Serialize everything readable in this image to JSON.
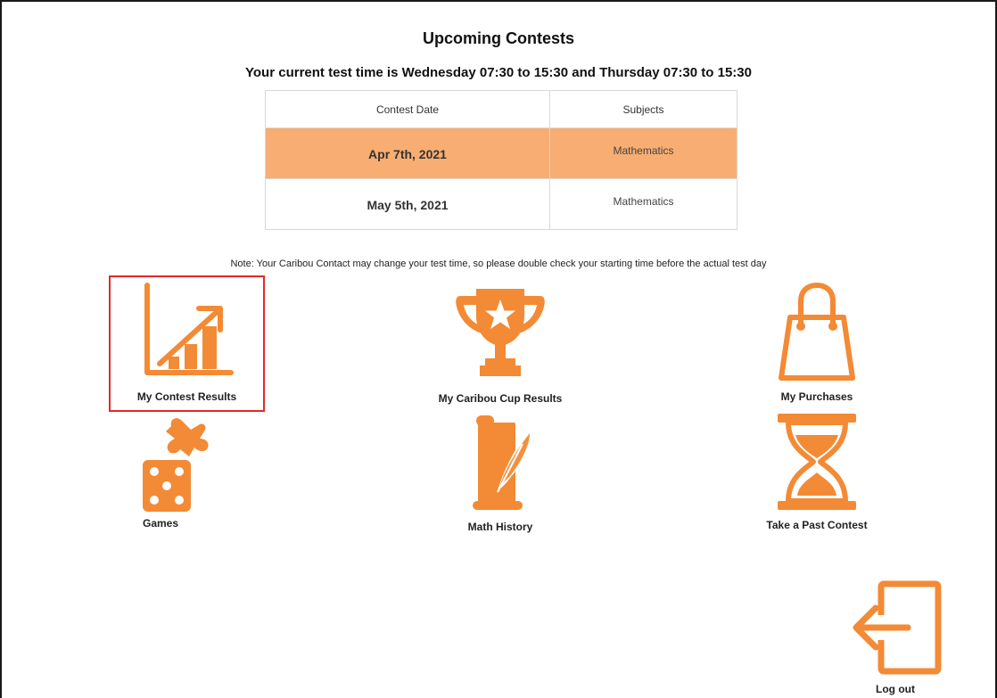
{
  "page": {
    "title": "Upcoming Contests",
    "subtitle": "Your current test time is Wednesday 07:30 to 15:30 and Thursday 07:30 to 15:30",
    "note": "Note: Your Caribou Contact may change your test time, so please double check your starting time before the actual test day"
  },
  "contests": {
    "headers": {
      "date": "Contest Date",
      "subjects": "Subjects"
    },
    "rows": [
      {
        "date": "Apr 7th, 2021",
        "subjects": "Mathematics",
        "highlighted": true
      },
      {
        "date": "May 5th, 2021",
        "subjects": "Mathematics",
        "highlighted": false
      }
    ]
  },
  "tiles": {
    "contest_results": {
      "label": "My Contest Results",
      "icon": "growth-chart-icon",
      "selected": true
    },
    "cup_results": {
      "label": "My Caribou Cup Results",
      "icon": "trophy-icon"
    },
    "purchases": {
      "label": "My Purchases",
      "icon": "shopping-bag-icon"
    },
    "games": {
      "label": "Games",
      "icon": "dice-puzzle-icon"
    },
    "math_history": {
      "label": "Math History",
      "icon": "scroll-quill-icon"
    },
    "past_contest": {
      "label": "Take a Past Contest",
      "icon": "hourglass-icon"
    },
    "logout": {
      "label": "Log out",
      "icon": "logout-icon"
    }
  },
  "colors": {
    "accent": "#f38a35",
    "highlight_row": "#f8ad72",
    "selection_border": "#e12a2a"
  }
}
